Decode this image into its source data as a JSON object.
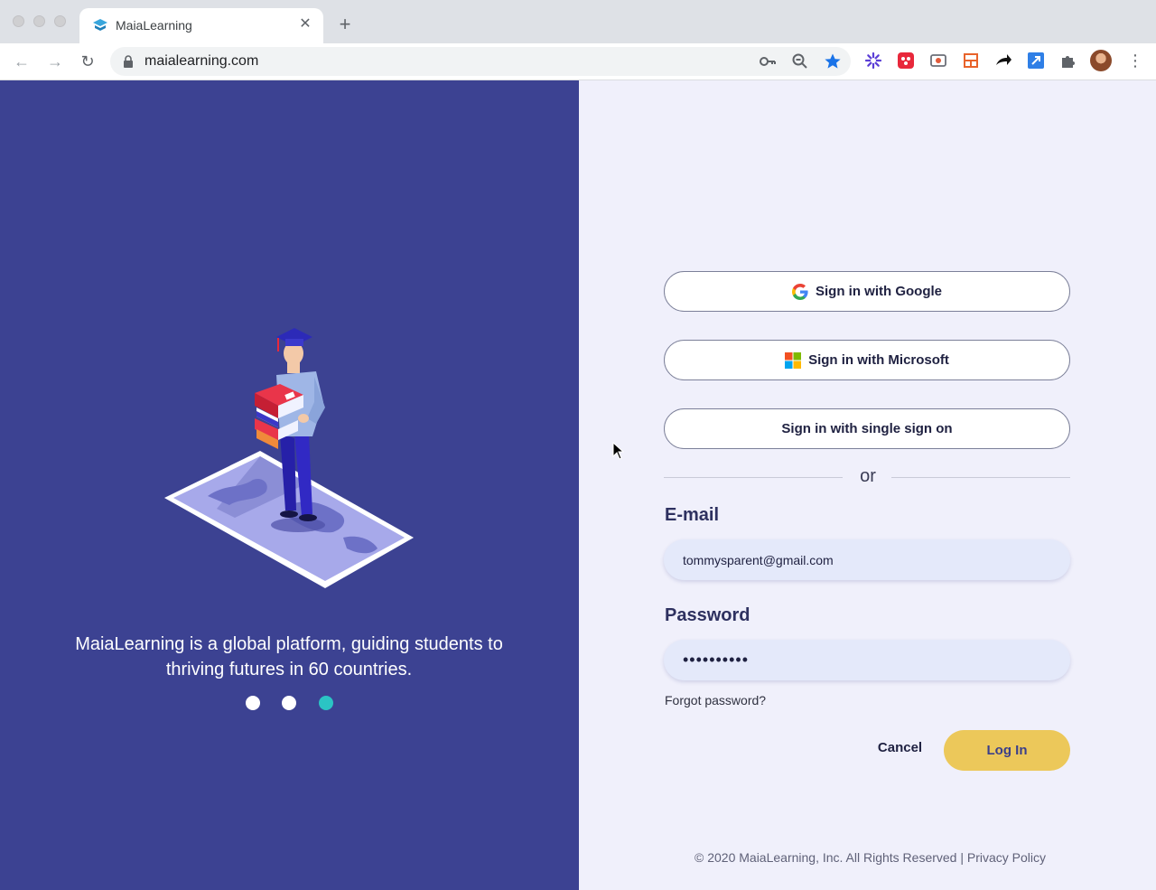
{
  "browser": {
    "tab_title": "MaiaLearning",
    "tab_close": "✕",
    "new_tab": "+",
    "url": "maialearning.com",
    "back": "←",
    "forward": "→",
    "reload": "↻",
    "menu": "⋮"
  },
  "hero": {
    "tagline": "MaiaLearning is a global platform, guiding students to thriving futures in 60 countries.",
    "carousel": {
      "slides": 3,
      "active_slide": 3
    }
  },
  "login": {
    "google_button": "Sign in with Google",
    "microsoft_button": "Sign in with Microsoft",
    "sso_button": "Sign in with single sign on",
    "or_text": "or",
    "email_label": "E-mail",
    "email_value": "tommysparent@gmail.com",
    "password_label": "Password",
    "password_value": "••••••••••",
    "forgot_link": "Forgot password?",
    "cancel_button": "Cancel",
    "login_button": "Log In"
  },
  "footer": {
    "copyright": "© 2020 MaiaLearning, Inc. All Rights Reserved | ",
    "privacy_link": "Privacy Policy"
  },
  "colors": {
    "left_panel": "#3c4292",
    "right_panel": "#f0f0fb",
    "accent_yellow": "#ecc85a",
    "dot_active": "#2bc4c4"
  }
}
